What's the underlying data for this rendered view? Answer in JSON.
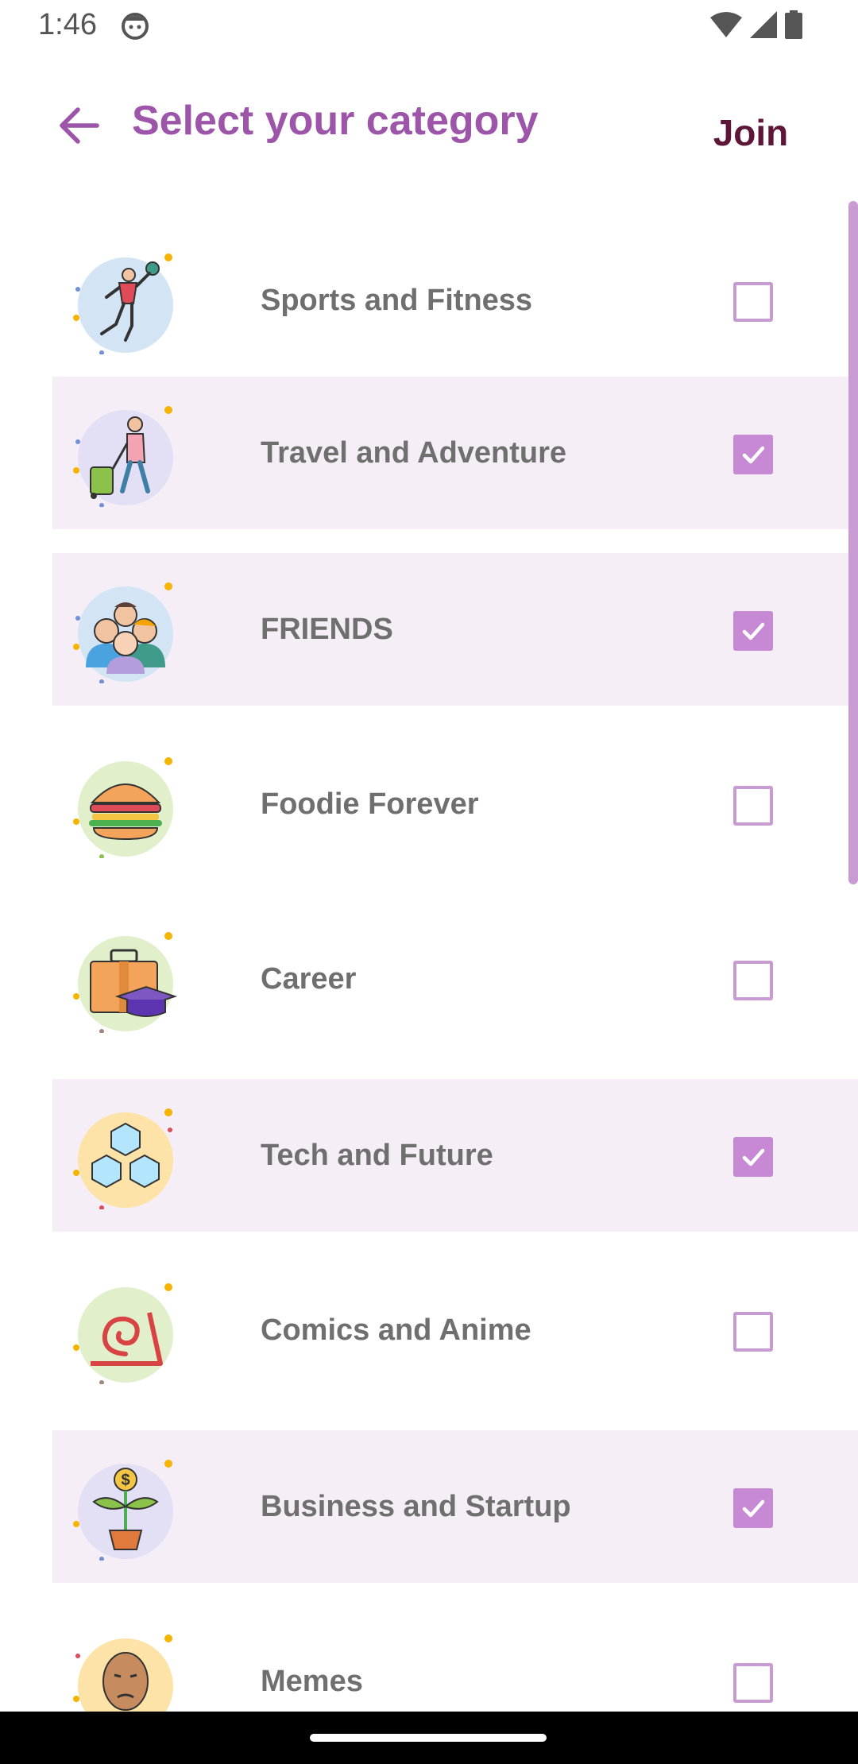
{
  "status_bar": {
    "time": "1:46",
    "icons": [
      "face-notification-icon",
      "wifi-icon",
      "signal-icon",
      "battery-icon"
    ]
  },
  "header": {
    "back_icon": "arrow-left-icon",
    "title": "Select your category",
    "join_label": "Join"
  },
  "colors": {
    "title": "#9c55a8",
    "join": "#5e1638",
    "selected_row_bg": "#f5eef6",
    "checkbox_checked": "#c889d4",
    "checkbox_border": "#c99bd3",
    "label_text": "#6f6f6f"
  },
  "categories": [
    {
      "label": "Sports and Fitness",
      "icon": "volleyball-player-icon",
      "checked": false
    },
    {
      "label": "Travel and Adventure",
      "icon": "traveler-luggage-icon",
      "checked": true
    },
    {
      "label": "FRIENDS",
      "icon": "group-of-friends-icon",
      "checked": true
    },
    {
      "label": "Foodie Forever",
      "icon": "burger-icon",
      "checked": false
    },
    {
      "label": "Career",
      "icon": "briefcase-graduation-cap-icon",
      "checked": false
    },
    {
      "label": "Tech and Future",
      "icon": "cubes-icon",
      "checked": true
    },
    {
      "label": "Comics and Anime",
      "icon": "leaf-village-swirl-icon",
      "checked": false
    },
    {
      "label": "Business and Startup",
      "icon": "money-plant-icon",
      "checked": true
    },
    {
      "label": "Memes",
      "icon": "meme-face-icon",
      "checked": false
    }
  ]
}
